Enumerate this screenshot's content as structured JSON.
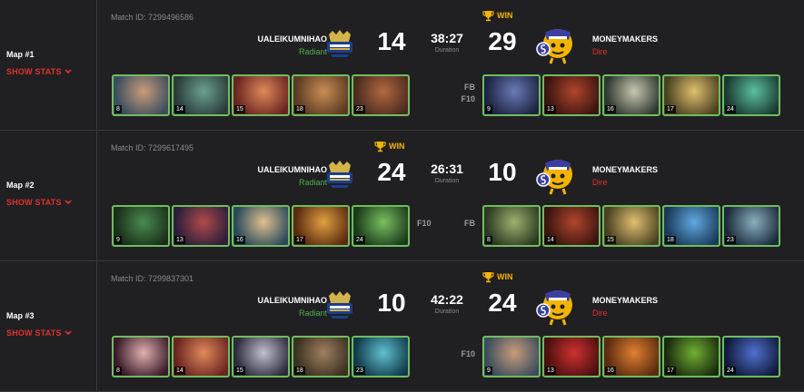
{
  "maps": [
    {
      "map_label": "Map #1",
      "show_stats": "SHOW STATS",
      "match_id": "Match ID: 7299496586",
      "left_team": {
        "name": "UALEIKUMNIHAO",
        "side": "Radiant",
        "score": "14"
      },
      "right_team": {
        "name": "MONEYMAKERS",
        "side": "Dire",
        "score": "29"
      },
      "duration": "38:27",
      "duration_label": "Duration",
      "winner": "right",
      "win_label": "WIN",
      "left_tags": "",
      "right_tags": "FB\nF10",
      "left_heroes": [
        {
          "level": "8",
          "colors": [
            "#3c4d5e",
            "#c89c7a"
          ]
        },
        {
          "level": "14",
          "colors": [
            "#2a3b3a",
            "#6aa08e"
          ]
        },
        {
          "level": "15",
          "colors": [
            "#6a2420",
            "#e08a5a"
          ]
        },
        {
          "level": "18",
          "colors": [
            "#5a3a22",
            "#c98d53"
          ]
        },
        {
          "level": "23",
          "colors": [
            "#4a2a20",
            "#b26a3e"
          ]
        }
      ],
      "right_heroes": [
        {
          "level": "9",
          "colors": [
            "#1e2340",
            "#6a7ab8"
          ]
        },
        {
          "level": "13",
          "colors": [
            "#3a1410",
            "#b0462c"
          ]
        },
        {
          "level": "16",
          "colors": [
            "#2e3830",
            "#c8c8b0"
          ]
        },
        {
          "level": "17",
          "colors": [
            "#4a4020",
            "#e0c070"
          ]
        },
        {
          "level": "24",
          "colors": [
            "#1a3a30",
            "#5ac0a0"
          ]
        }
      ]
    },
    {
      "map_label": "Map #2",
      "show_stats": "SHOW STATS",
      "match_id": "Match ID: 7299617495",
      "left_team": {
        "name": "UALEIKUMNIHAO",
        "side": "Radiant",
        "score": "24"
      },
      "right_team": {
        "name": "MONEYMAKERS",
        "side": "Dire",
        "score": "10"
      },
      "duration": "26:31",
      "duration_label": "Duration",
      "winner": "left",
      "win_label": "WIN",
      "left_tags": "F10",
      "right_tags": "FB",
      "left_heroes": [
        {
          "level": "9",
          "colors": [
            "#1a2e1a",
            "#4a8a50"
          ]
        },
        {
          "level": "13",
          "colors": [
            "#2a1e3a",
            "#b04a4a"
          ]
        },
        {
          "level": "16",
          "colors": [
            "#2a4a5a",
            "#e0c090"
          ]
        },
        {
          "level": "17",
          "colors": [
            "#5a2a10",
            "#e0a040"
          ]
        },
        {
          "level": "24",
          "colors": [
            "#1a3a1a",
            "#7ac060"
          ]
        }
      ],
      "right_heroes": [
        {
          "level": "8",
          "colors": [
            "#2a3a20",
            "#a0b070"
          ]
        },
        {
          "level": "14",
          "colors": [
            "#3a1410",
            "#b0462c"
          ]
        },
        {
          "level": "15",
          "colors": [
            "#4a4020",
            "#e0c070"
          ]
        },
        {
          "level": "18",
          "colors": [
            "#1a3a5a",
            "#60a8e0"
          ]
        },
        {
          "level": "23",
          "colors": [
            "#1a2a3a",
            "#8ab0c0"
          ]
        }
      ]
    },
    {
      "map_label": "Map #3",
      "show_stats": "SHOW STATS",
      "match_id": "Match ID: 7299837301",
      "left_team": {
        "name": "UALEIKUMNIHAO",
        "side": "Radiant",
        "score": "10"
      },
      "right_team": {
        "name": "MONEYMAKERS",
        "side": "Dire",
        "score": "24"
      },
      "duration": "42:22",
      "duration_label": "Duration",
      "winner": "right",
      "win_label": "WIN",
      "left_tags": "",
      "right_tags": "F10",
      "left_heroes": [
        {
          "level": "8",
          "colors": [
            "#3a1a2a",
            "#e0b0b0"
          ]
        },
        {
          "level": "14",
          "colors": [
            "#6a2420",
            "#e08a5a"
          ]
        },
        {
          "level": "15",
          "colors": [
            "#2a2a3a",
            "#c0c0d0"
          ]
        },
        {
          "level": "18",
          "colors": [
            "#3a3020",
            "#a08060"
          ]
        },
        {
          "level": "23",
          "colors": [
            "#103a4a",
            "#60c0d0"
          ]
        }
      ],
      "right_heroes": [
        {
          "level": "9",
          "colors": [
            "#3c4d5e",
            "#c89c7a"
          ]
        },
        {
          "level": "13",
          "colors": [
            "#4a1010",
            "#d03030"
          ]
        },
        {
          "level": "16",
          "colors": [
            "#5a2a10",
            "#e08030"
          ]
        },
        {
          "level": "17",
          "colors": [
            "#1a2a10",
            "#70b030"
          ]
        },
        {
          "level": "24",
          "colors": [
            "#101a3a",
            "#5070d0"
          ]
        }
      ]
    }
  ],
  "colors": {
    "win": "#f5b400",
    "radiant": "#4caf50",
    "dire": "#e0322f",
    "hero_border": "#6fbd5f"
  },
  "icons": {
    "trophy": "trophy-icon",
    "chevron": "chevron-down-icon"
  }
}
